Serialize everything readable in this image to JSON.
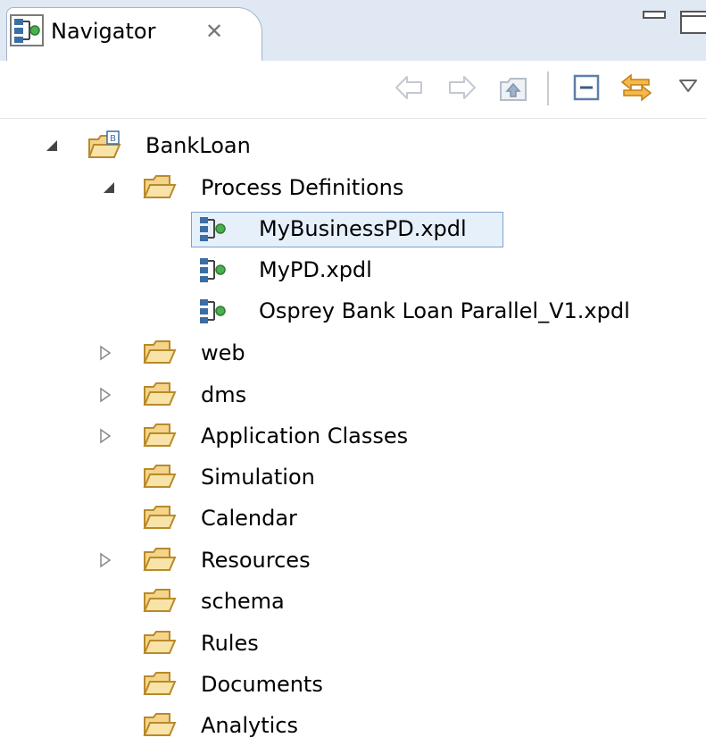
{
  "view": {
    "tab_label": "Navigator",
    "tab_close_glyph": "✕",
    "tab_icon": "process-definition-icon",
    "window_controls": [
      "minimize-icon",
      "maximize-icon"
    ]
  },
  "toolbar": {
    "buttons": [
      "back-arrow-icon",
      "forward-arrow-icon",
      "up-folder-icon",
      "collapse-all-icon",
      "link-with-editor-icon",
      "view-menu-icon"
    ]
  },
  "tree": {
    "root": {
      "label": "BankLoan",
      "expanded": true,
      "icon": "project-folder-icon"
    },
    "process_definitions": {
      "label": "Process Definitions",
      "expanded": true,
      "files": [
        "MyBusinessPD.xpdl",
        "MyPD.xpdl",
        "Osprey Bank Loan Parallel_V1.xpdl"
      ],
      "selected_file": "MyBusinessPD.xpdl"
    },
    "folders": [
      {
        "label": "web",
        "expandable": true
      },
      {
        "label": "dms",
        "expandable": true
      },
      {
        "label": "Application Classes",
        "expandable": true
      },
      {
        "label": "Simulation",
        "expandable": false
      },
      {
        "label": "Calendar",
        "expandable": false
      },
      {
        "label": "Resources",
        "expandable": true
      },
      {
        "label": "schema",
        "expandable": false
      },
      {
        "label": "Rules",
        "expandable": false
      },
      {
        "label": "Documents",
        "expandable": false
      },
      {
        "label": "Analytics",
        "expandable": false
      }
    ]
  },
  "colors": {
    "header_bg": "#dfe8f3",
    "selection_border": "#7da2ce",
    "selection_bg": "#e6f0fa",
    "folder_fill": "#f4d48a",
    "folder_stroke": "#b98a2a",
    "arrow_disabled": "#c3c9d2",
    "link_arrows": "#e8a02a"
  }
}
